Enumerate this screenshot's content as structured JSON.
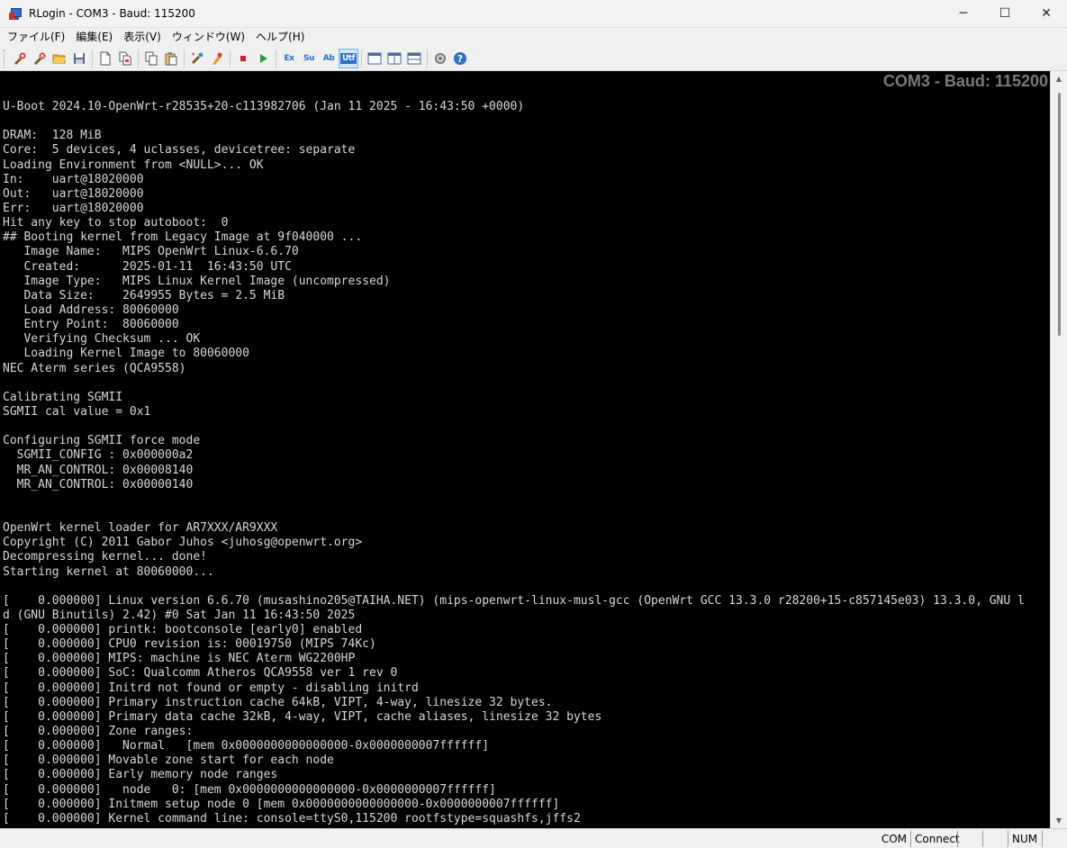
{
  "window": {
    "title": "RLogin - COM3 - Baud: 115200",
    "minimize": "─",
    "maximize": "☐",
    "close": "✕"
  },
  "menu": [
    "ファイル(F)",
    "編集(E)",
    "表示(V)",
    "ウィンドウ(W)",
    "ヘルプ(H)"
  ],
  "toolbar": {
    "icons": [
      "new-connection-icon",
      "disconnect-icon",
      "open-folder-icon",
      "save-icon",
      "new-document-icon",
      "copy-document-icon",
      "copy-icon",
      "paste-icon",
      "script-icon",
      "clear-icon",
      "stop-icon",
      "play-icon",
      "font-ex-icon",
      "font-su-icon",
      "font-ab-icon",
      "utf-icon",
      "layout-1-icon",
      "layout-2-icon",
      "layout-3-icon",
      "settings-icon",
      "help-icon"
    ],
    "text_labels": {
      "ex": "Ex",
      "su": "Su",
      "ab": "Ab",
      "utf": "Utf"
    }
  },
  "terminal": {
    "banner": "COM3 - Baud: 115200",
    "lines": [
      "U-Boot 2024.10-OpenWrt-r28535+20-c113982706 (Jan 11 2025 - 16:43:50 +0000)",
      "",
      "DRAM:  128 MiB",
      "Core:  5 devices, 4 uclasses, devicetree: separate",
      "Loading Environment from <NULL>... OK",
      "In:    uart@18020000",
      "Out:   uart@18020000",
      "Err:   uart@18020000",
      "Hit any key to stop autoboot:  0",
      "## Booting kernel from Legacy Image at 9f040000 ...",
      "   Image Name:   MIPS OpenWrt Linux-6.6.70",
      "   Created:      2025-01-11  16:43:50 UTC",
      "   Image Type:   MIPS Linux Kernel Image (uncompressed)",
      "   Data Size:    2649955 Bytes = 2.5 MiB",
      "   Load Address: 80060000",
      "   Entry Point:  80060000",
      "   Verifying Checksum ... OK",
      "   Loading Kernel Image to 80060000",
      "NEC Aterm series (QCA9558)",
      "",
      "Calibrating SGMII",
      "SGMII cal value = 0x1",
      "",
      "Configuring SGMII force mode",
      "  SGMII_CONFIG : 0x000000a2",
      "  MR_AN_CONTROL: 0x00008140",
      "  MR_AN_CONTROL: 0x00000140",
      "",
      "",
      "OpenWrt kernel loader for AR7XXX/AR9XXX",
      "Copyright (C) 2011 Gabor Juhos <juhosg@openwrt.org>",
      "Decompressing kernel... done!",
      "Starting kernel at 80060000...",
      "",
      "[    0.000000] Linux version 6.6.70 (musashino205@TAIHA.NET) (mips-openwrt-linux-musl-gcc (OpenWrt GCC 13.3.0 r28200+15-c857145e03) 13.3.0, GNU l",
      "d (GNU Binutils) 2.42) #0 Sat Jan 11 16:43:50 2025",
      "[    0.000000] printk: bootconsole [early0] enabled",
      "[    0.000000] CPU0 revision is: 00019750 (MIPS 74Kc)",
      "[    0.000000] MIPS: machine is NEC Aterm WG2200HP",
      "[    0.000000] SoC: Qualcomm Atheros QCA9558 ver 1 rev 0",
      "[    0.000000] Initrd not found or empty - disabling initrd",
      "[    0.000000] Primary instruction cache 64kB, VIPT, 4-way, linesize 32 bytes.",
      "[    0.000000] Primary data cache 32kB, 4-way, VIPT, cache aliases, linesize 32 bytes",
      "[    0.000000] Zone ranges:",
      "[    0.000000]   Normal   [mem 0x0000000000000000-0x0000000007ffffff]",
      "[    0.000000] Movable zone start for each node",
      "[    0.000000] Early memory node ranges",
      "[    0.000000]   node   0: [mem 0x0000000000000000-0x0000000007ffffff]",
      "[    0.000000] Initmem setup node 0 [mem 0x0000000000000000-0x0000000007ffffff]",
      "[    0.000000] Kernel command line: console=ttyS0,115200 rootfstype=squashfs,jffs2"
    ]
  },
  "status": {
    "com": "COM",
    "connect": "Connect",
    "num": "NUM"
  }
}
